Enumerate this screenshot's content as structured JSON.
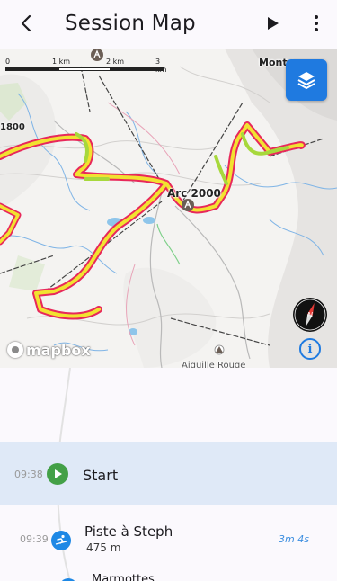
{
  "appbar": {
    "title": "Session Map",
    "back_icon": "arrow-back-icon",
    "play_icon": "play-icon",
    "more_icon": "more-vert-icon"
  },
  "map": {
    "scale": {
      "labels": [
        "0",
        "1 km",
        "2 km",
        "3 km"
      ]
    },
    "places": [
      {
        "name": "Arc 2000"
      },
      {
        "name": "1800"
      },
      {
        "name": "Monty"
      },
      {
        "name": "Aiguille Rouge"
      }
    ],
    "attribution": "mapbox",
    "layers_icon": "layers-icon",
    "compass_icon": "compass-icon",
    "compass_label": "N",
    "info_icon": "info-icon",
    "info_label": "i",
    "colors": {
      "track_red": "#e8285a",
      "track_yellow": "#f2e230",
      "track_green": "#a7d83c",
      "accent": "#1f7ae0"
    }
  },
  "sessions": [
    {
      "time": "09:38",
      "title": "Start",
      "subtitle": "",
      "duration": "",
      "icon": "play-icon",
      "color": "#43a047",
      "selected": true
    },
    {
      "time": "09:39",
      "title": "Piste à Steph",
      "subtitle": "475 m",
      "duration": "3m 4s",
      "icon": "skier-icon",
      "color": "#1e88e5",
      "selected": false
    },
    {
      "time": "",
      "title": "Marmottes",
      "subtitle": "",
      "duration": "",
      "icon": "lift-icon",
      "color": "#1e88e5",
      "selected": false
    }
  ]
}
